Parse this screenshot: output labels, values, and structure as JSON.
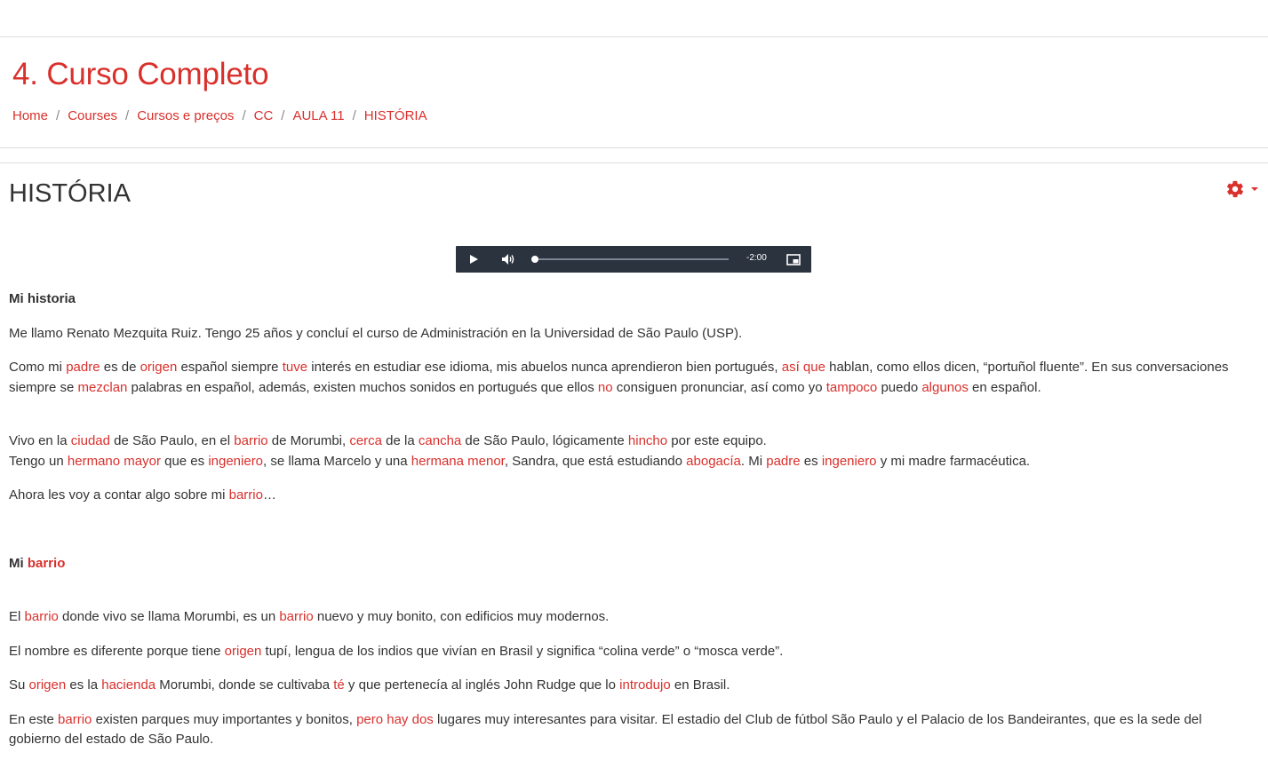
{
  "header": {
    "course_title": "4. Curso Completo",
    "breadcrumb": [
      {
        "label": "Home"
      },
      {
        "label": "Courses"
      },
      {
        "label": "Cursos e preços"
      },
      {
        "label": "CC"
      },
      {
        "label": "AULA 11"
      },
      {
        "label": "HISTÓRIA"
      }
    ],
    "separator": "/"
  },
  "page": {
    "title": "HISTÓRIA",
    "settings_icon": "gear-icon",
    "dropdown_icon": "caret-down-icon"
  },
  "player": {
    "play_icon": "play-icon",
    "volume_icon": "volume-icon",
    "pip_icon": "picture-in-picture-icon",
    "time_remaining": "-2:00",
    "progress": 0.0
  },
  "text": {
    "h1": "Mi historia",
    "p1": "Me llamo Renato Mezquita Ruiz. Tengo 25 años y concluí el curso de Administración en la Universidad de São Paulo (USP).",
    "p2": [
      {
        "t": "Como mi "
      },
      {
        "t": "padre",
        "hl": true
      },
      {
        "t": " es de "
      },
      {
        "t": "origen",
        "hl": true
      },
      {
        "t": " español siempre "
      },
      {
        "t": "tuve",
        "hl": true
      },
      {
        "t": " interés en estudiar ese idioma,  mis abuelos nunca aprendieron bien portugués, "
      },
      {
        "t": "así que",
        "hl": true
      },
      {
        "t": " hablan, como ellos dicen, “portuñol fluente”. En sus conversaciones siempre se "
      },
      {
        "t": "mezclan",
        "hl": true
      },
      {
        "t": " palabras en español, además, existen muchos sonidos en portugués que ellos "
      },
      {
        "t": "no",
        "hl": true
      },
      {
        "t": " consiguen pronunciar, así como yo "
      },
      {
        "t": "tampoco",
        "hl": true
      },
      {
        "t": " puedo "
      },
      {
        "t": "algunos",
        "hl": true
      },
      {
        "t": " en español."
      }
    ],
    "p3a": [
      {
        "t": "Vivo en la "
      },
      {
        "t": "ciudad",
        "hl": true
      },
      {
        "t": " de São Paulo, en el "
      },
      {
        "t": "barrio",
        "hl": true
      },
      {
        "t": " de Morumbi, "
      },
      {
        "t": "cerca",
        "hl": true
      },
      {
        "t": " de la "
      },
      {
        "t": "cancha",
        "hl": true
      },
      {
        "t": " de São Paulo, lógicamente "
      },
      {
        "t": "hincho",
        "hl": true
      },
      {
        "t": " por este equipo."
      }
    ],
    "p3b": [
      {
        "t": "Tengo un "
      },
      {
        "t": "hermano mayor",
        "hl": true
      },
      {
        "t": " que es "
      },
      {
        "t": "ingeniero",
        "hl": true
      },
      {
        "t": ", se llama Marcelo y una "
      },
      {
        "t": "hermana menor",
        "hl": true
      },
      {
        "t": ", Sandra, que está estudiando "
      },
      {
        "t": "abogacía",
        "hl": true
      },
      {
        "t": ". Mi "
      },
      {
        "t": "padre",
        "hl": true
      },
      {
        "t": " es "
      },
      {
        "t": "ingeniero",
        "hl": true
      },
      {
        "t": " y mi madre farmacéutica."
      }
    ],
    "p4": [
      {
        "t": "Ahora les voy a contar algo sobre mi "
      },
      {
        "t": "barrio",
        "hl": true
      },
      {
        "t": "…"
      }
    ],
    "h2": [
      {
        "t": "Mi "
      },
      {
        "t": "barrio",
        "hl": true
      }
    ],
    "p5": [
      {
        "t": "El "
      },
      {
        "t": "barrio",
        "hl": true
      },
      {
        "t": " donde vivo se llama Morumbi, es un "
      },
      {
        "t": "barrio",
        "hl": true
      },
      {
        "t": " nuevo y muy bonito, con edificios muy modernos."
      }
    ],
    "p6": [
      {
        "t": "El nombre es diferente porque tiene "
      },
      {
        "t": "origen",
        "hl": true
      },
      {
        "t": " tupí, lengua de los indios que vivían en Brasil y significa “colina verde” o “mosca verde”."
      }
    ],
    "p7": [
      {
        "t": "Su "
      },
      {
        "t": "origen",
        "hl": true
      },
      {
        "t": " es la "
      },
      {
        "t": "hacienda",
        "hl": true
      },
      {
        "t": " Morumbi, donde se cultivaba "
      },
      {
        "t": "té",
        "hl": true
      },
      {
        "t": " y que pertenecía al inglés John Rudge que lo "
      },
      {
        "t": "introdujo",
        "hl": true
      },
      {
        "t": " en Brasil."
      }
    ],
    "p8": [
      {
        "t": "En este "
      },
      {
        "t": "barrio",
        "hl": true
      },
      {
        "t": " existen parques muy importantes y bonitos, "
      },
      {
        "t": "pero hay dos",
        "hl": true
      },
      {
        "t": " lugares muy interesantes para visitar. El estadio del Club de fútbol São Paulo y el Palacio de los Bandeirantes, que es la sede del gobierno del estado de São Paulo."
      }
    ]
  }
}
